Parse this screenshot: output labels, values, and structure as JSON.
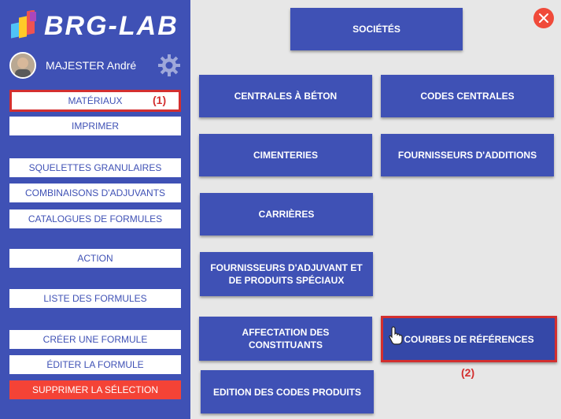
{
  "app": {
    "logo_text": "BRG-LAB"
  },
  "user": {
    "name": "MAJESTER André"
  },
  "sidebar": {
    "items": [
      {
        "label": "MATÉRIAUX"
      },
      {
        "label": "IMPRIMER"
      },
      {
        "label": "SQUELETTES GRANULAIRES"
      },
      {
        "label": "COMBINAISONS D'ADJUVANTS"
      },
      {
        "label": "CATALOGUES DE FORMULES"
      },
      {
        "label": "ACTION"
      },
      {
        "label": "LISTE DES FORMULES"
      },
      {
        "label": "CRÉER UNE FORMULE"
      },
      {
        "label": "ÉDITER LA FORMULE"
      },
      {
        "label": "SUPPRIMER LA SÉLECTION"
      }
    ]
  },
  "annotations": {
    "one": "(1)",
    "two": "(2)"
  },
  "main": {
    "buttons": [
      {
        "label": "SOCIÉTÉS"
      },
      {
        "label": "CENTRALES À BÉTON"
      },
      {
        "label": "CODES CENTRALES"
      },
      {
        "label": "CIMENTERIES"
      },
      {
        "label": "FOURNISSEURS D'ADDITIONS"
      },
      {
        "label": "CARRIÈRES"
      },
      {
        "label": "FOURNISSEURS D'ADJUVANT ET DE PRODUITS SPÉCIAUX"
      },
      {
        "label": "AFFECTATION DES CONSTITUANTS"
      },
      {
        "label": "COURBES DE RÉFÉRENCES"
      },
      {
        "label": "EDITION DES CODES PRODUITS"
      }
    ]
  },
  "icons": {
    "logo": "brg-lab-logo-icon",
    "gear": "gear-icon",
    "close": "close-icon",
    "cursor": "hand-cursor-icon"
  },
  "colors": {
    "primary": "#3f51b5",
    "danger": "#f44336",
    "annotation": "#d32f2f",
    "background": "#e7e7e7"
  }
}
